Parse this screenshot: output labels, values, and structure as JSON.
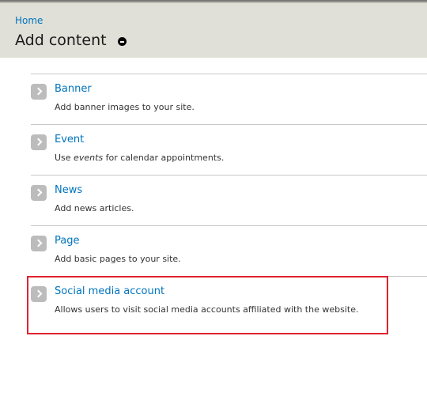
{
  "header": {
    "breadcrumb": "Home",
    "title": "Add content",
    "shortcut_icon": "remove-shortcut-icon"
  },
  "content_types": [
    {
      "title": "Banner",
      "description": "Add banner images to your site."
    },
    {
      "title": "Event",
      "description_before": "Use ",
      "description_em": "events",
      "description_after": " for calendar appointments."
    },
    {
      "title": "News",
      "description": "Add news articles."
    },
    {
      "title": "Page",
      "description": "Add basic pages to your site."
    },
    {
      "title": "Social media account",
      "description": "Allows users to visit social media accounts affiliated with the website.",
      "highlighted": true
    }
  ],
  "colors": {
    "link": "#0074bd",
    "header_bg": "#e0e0d8",
    "highlight_border": "#e0222e",
    "arrow_bg": "#bcbcbc"
  },
  "icons": {
    "item_arrow": "chevron-right-icon"
  }
}
